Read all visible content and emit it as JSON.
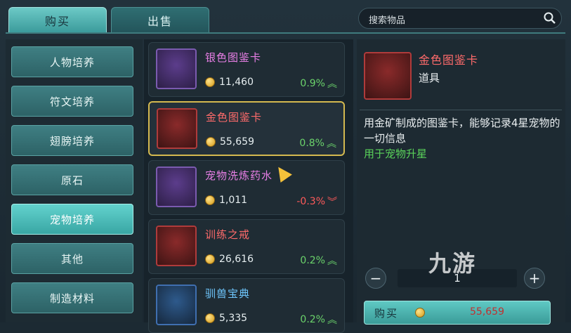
{
  "tabs": {
    "buy": "购买",
    "sell": "出售"
  },
  "search": {
    "placeholder": "搜索物品"
  },
  "categories": [
    {
      "label": "人物培养"
    },
    {
      "label": "符文培养"
    },
    {
      "label": "翅膀培养"
    },
    {
      "label": "原石"
    },
    {
      "label": "宠物培养",
      "active": true
    },
    {
      "label": "其他"
    },
    {
      "label": "制造材料"
    }
  ],
  "items": [
    {
      "name": "银色图鉴卡",
      "price": "11,460",
      "change": "0.9%",
      "trend": "up"
    },
    {
      "name": "金色图鉴卡",
      "price": "55,659",
      "change": "0.8%",
      "trend": "up"
    },
    {
      "name": "宠物洗炼药水",
      "price": "1,011",
      "change": "-0.3%",
      "trend": "down"
    },
    {
      "name": "训练之戒",
      "price": "26,616",
      "change": "0.2%",
      "trend": "up"
    },
    {
      "name": "驯兽宝典",
      "price": "5,335",
      "change": "0.2%",
      "trend": "up"
    }
  ],
  "detail": {
    "name": "金色图鉴卡",
    "type": "道具",
    "description": "用金矿制成的图鉴卡，能够记录4星宠物的一切信息",
    "usage": "用于宠物升星",
    "quantity": "1",
    "buy_label": "购买",
    "total": "55,659"
  },
  "watermark": "九游",
  "colors": {
    "accent": "#4fb9b5",
    "selected_border": "#d4b94f",
    "up": "#6bd36b",
    "down": "#ff5a5a"
  }
}
